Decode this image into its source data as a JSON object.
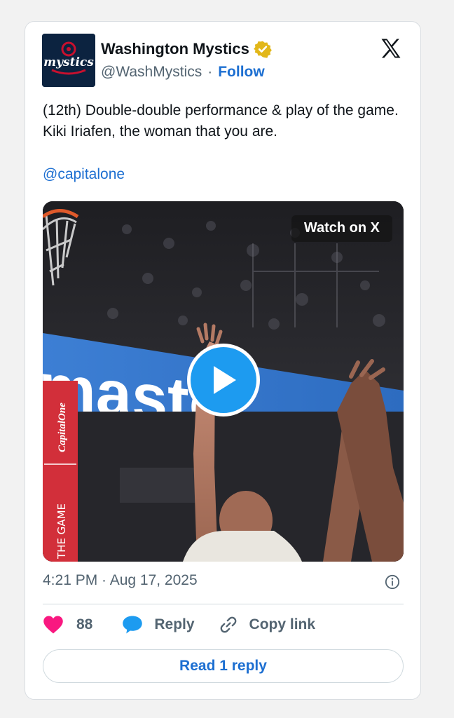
{
  "account": {
    "name": "Washington Mystics",
    "handle": "@WashMystics",
    "separator": "·",
    "follow_label": "Follow",
    "avatar_text": "mystics",
    "avatar_icon": "team-logo-icon",
    "verified_icon": "verified-badge-icon",
    "verified_color": "#e2b719"
  },
  "platform_icon": "x-logo-icon",
  "tweet": {
    "text": "(12th) Double-double performance & play of the game. Kiki Iriafen, the woman that you are.",
    "mention": "@capitalone"
  },
  "media": {
    "watch_label": "Watch on X",
    "play_icon": "play-icon",
    "board_text": "maste",
    "sponsor_text": "CapitalOne",
    "sponsor_tagline": "THE GAME"
  },
  "meta": {
    "timestamp": "4:21 PM · Aug 17, 2025",
    "info_icon": "info-icon"
  },
  "actions": {
    "like_count": "88",
    "reply_label": "Reply",
    "copy_link_label": "Copy link",
    "read_replies_label": "Read 1 reply"
  },
  "colors": {
    "accent": "#1d6fd1",
    "heart": "#f91880",
    "reply_bubble": "#1d9bf0",
    "play_button": "#1d9bf0"
  }
}
